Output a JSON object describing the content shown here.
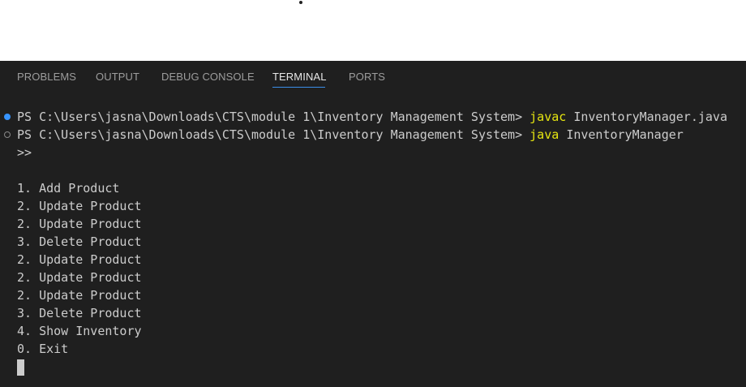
{
  "panel_tabs": [
    {
      "label": "PROBLEMS",
      "active": false
    },
    {
      "label": "OUTPUT",
      "active": false
    },
    {
      "label": "DEBUG CONSOLE",
      "active": false
    },
    {
      "label": "TERMINAL",
      "active": true
    },
    {
      "label": "PORTS",
      "active": false
    }
  ],
  "terminal": {
    "prompt": "PS C:\\Users\\jasna\\Downloads\\CTS\\module 1\\Inventory Management System> ",
    "commands": [
      {
        "cmd": "javac",
        "args": "InventoryManager.java"
      },
      {
        "cmd": "java",
        "args": "InventoryManager"
      }
    ],
    "continuation": ">>",
    "menu_lines": [
      "1. Add Product",
      "2. Update Product",
      "2. Update Product",
      "3. Delete Product",
      "2. Update Product",
      "2. Update Product",
      "2. Update Product",
      "3. Delete Product",
      "4. Show Inventory",
      "0. Exit"
    ]
  },
  "colors": {
    "panel_bg": "#1f1f1f",
    "terminal_text": "#cccccc",
    "command_keyword": "#e5e510",
    "active_tab_underline": "#3b8eea",
    "success_decoration": "#3794ff"
  }
}
